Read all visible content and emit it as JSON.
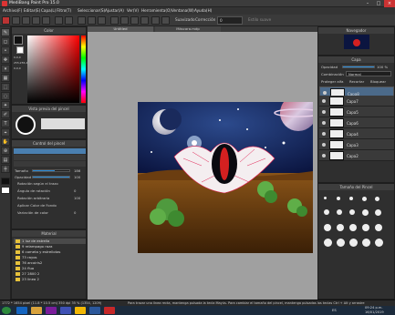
{
  "window": {
    "title": "MediBang Paint Pro 15.0"
  },
  "menu": [
    "Archivo(F)",
    "Editar(E)",
    "Capa(L)",
    "Filtro(T)",
    "Seleccionar(S)",
    "Ajustar(A)",
    "Ver(V)",
    "Herramienta(O)",
    "Ventana(W)",
    "Ayuda(H)"
  ],
  "toolbar": {
    "suavizado_label": "Suavizado",
    "correccion_label": "Corrección",
    "correccion_value": "0",
    "tab_label": "Untitled",
    "tab2_label": "Máscara.mdp",
    "extra_label": "Estilo suave"
  },
  "color_panel": {
    "title": "Color",
    "hex1": "0,0,0",
    "hex2": "255,255,255",
    "hex3": "0,0,0"
  },
  "brush_panel": {
    "title": "Vista previa del pincel",
    "control_title": "Control del pincel",
    "size_label": "Tamaño",
    "size_value": "186",
    "opacity_label": "Opacidad",
    "opacity_value": "100",
    "opt1": "Rotación según el trazo",
    "opt2": "Ángulo de rotación",
    "opt2_value": "0",
    "opt3": "Rotación arbitraria",
    "opt3_value": "100",
    "opt4": "Aplicar Color de Fondo",
    "opt5": "Variación de color",
    "opt5_value": "0"
  },
  "files_panel": {
    "title": "Material",
    "items": [
      "luz de estrella",
      "relampago raza",
      "cometa y estrellotas",
      "rayos",
      "arcoiris2",
      "fluo",
      "2800 2",
      "linea 2"
    ],
    "counts": [
      "1",
      "9",
      "6",
      "73",
      "76",
      "24",
      "27",
      "23"
    ]
  },
  "navigator": {
    "title": "Navegador"
  },
  "layers": {
    "title": "Capa",
    "opacity_label": "Opacidad",
    "opacity_value": "100 %",
    "blend_label": "Combinación",
    "blend_value": "Normal",
    "protect": "Proteger alfa",
    "clip": "Recortar",
    "lock": "Bloquear",
    "items": [
      "Capa8",
      "Capa7",
      "Capa5",
      "Capa6",
      "Capa4",
      "Capa3",
      "Capa2"
    ]
  },
  "brush_size": {
    "title": "Tamaño del Pincel"
  },
  "status": {
    "left": "1772 * 1654 pixel (11.8 * 10.5 cm) 350 dpi 35 % (1354, 1209)",
    "hint": "Para trazar una línea recta, mantenga pulsada la tecla Mayús. Para cambiar el tamaño del pincel, mantenga pulsadas las teclas Ctrl + Alt y arrastre"
  },
  "taskbar": {
    "lang": "ES",
    "time": "09:24 p.m.",
    "date": "16/01/2019"
  },
  "colors": {
    "accent": "#2a8ad6",
    "canvas_bg": "#a0a0a0",
    "selected_layer": "#4b6a8a"
  }
}
